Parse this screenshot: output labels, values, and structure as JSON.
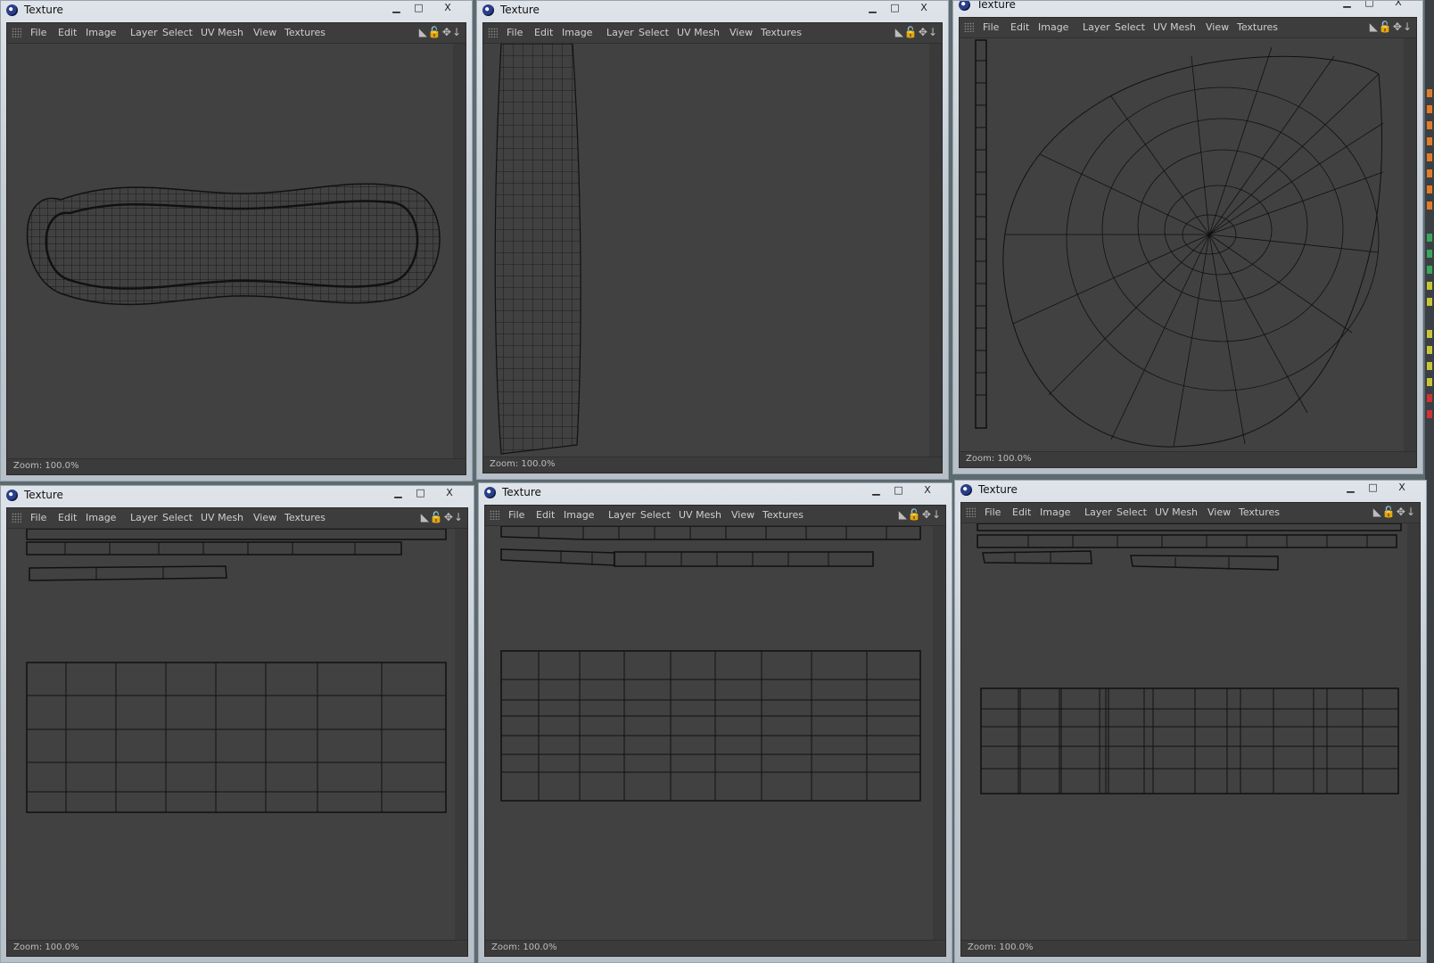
{
  "window_title": "Texture",
  "menu": [
    "File",
    "Edit",
    "Image",
    "Layer",
    "Select",
    "UV Mesh",
    "View",
    "Textures"
  ],
  "status": "Zoom: 100.0%",
  "controls": {
    "minimize": "▁",
    "maximize": "□",
    "close": "X"
  },
  "icons": [
    "uv-mesh-icon",
    "lock-icon",
    "move-icon",
    "dock-arrow-icon"
  ],
  "windows": [
    {
      "name": "texture-window-1",
      "mesh": "bean-shaped uv layout"
    },
    {
      "name": "texture-window-2",
      "mesh": "vertical strip uv layout"
    },
    {
      "name": "texture-window-3",
      "mesh": "radial teardrop uv layout"
    },
    {
      "name": "texture-window-4",
      "mesh": "strips and grid uv layout"
    },
    {
      "name": "texture-window-5",
      "mesh": "strips and grid uv layout"
    },
    {
      "name": "texture-window-6",
      "mesh": "strips and grid uv layout"
    }
  ],
  "colors": {
    "canvas": "#414141",
    "wire": "#111111",
    "chrome": "#c4ccd4"
  }
}
